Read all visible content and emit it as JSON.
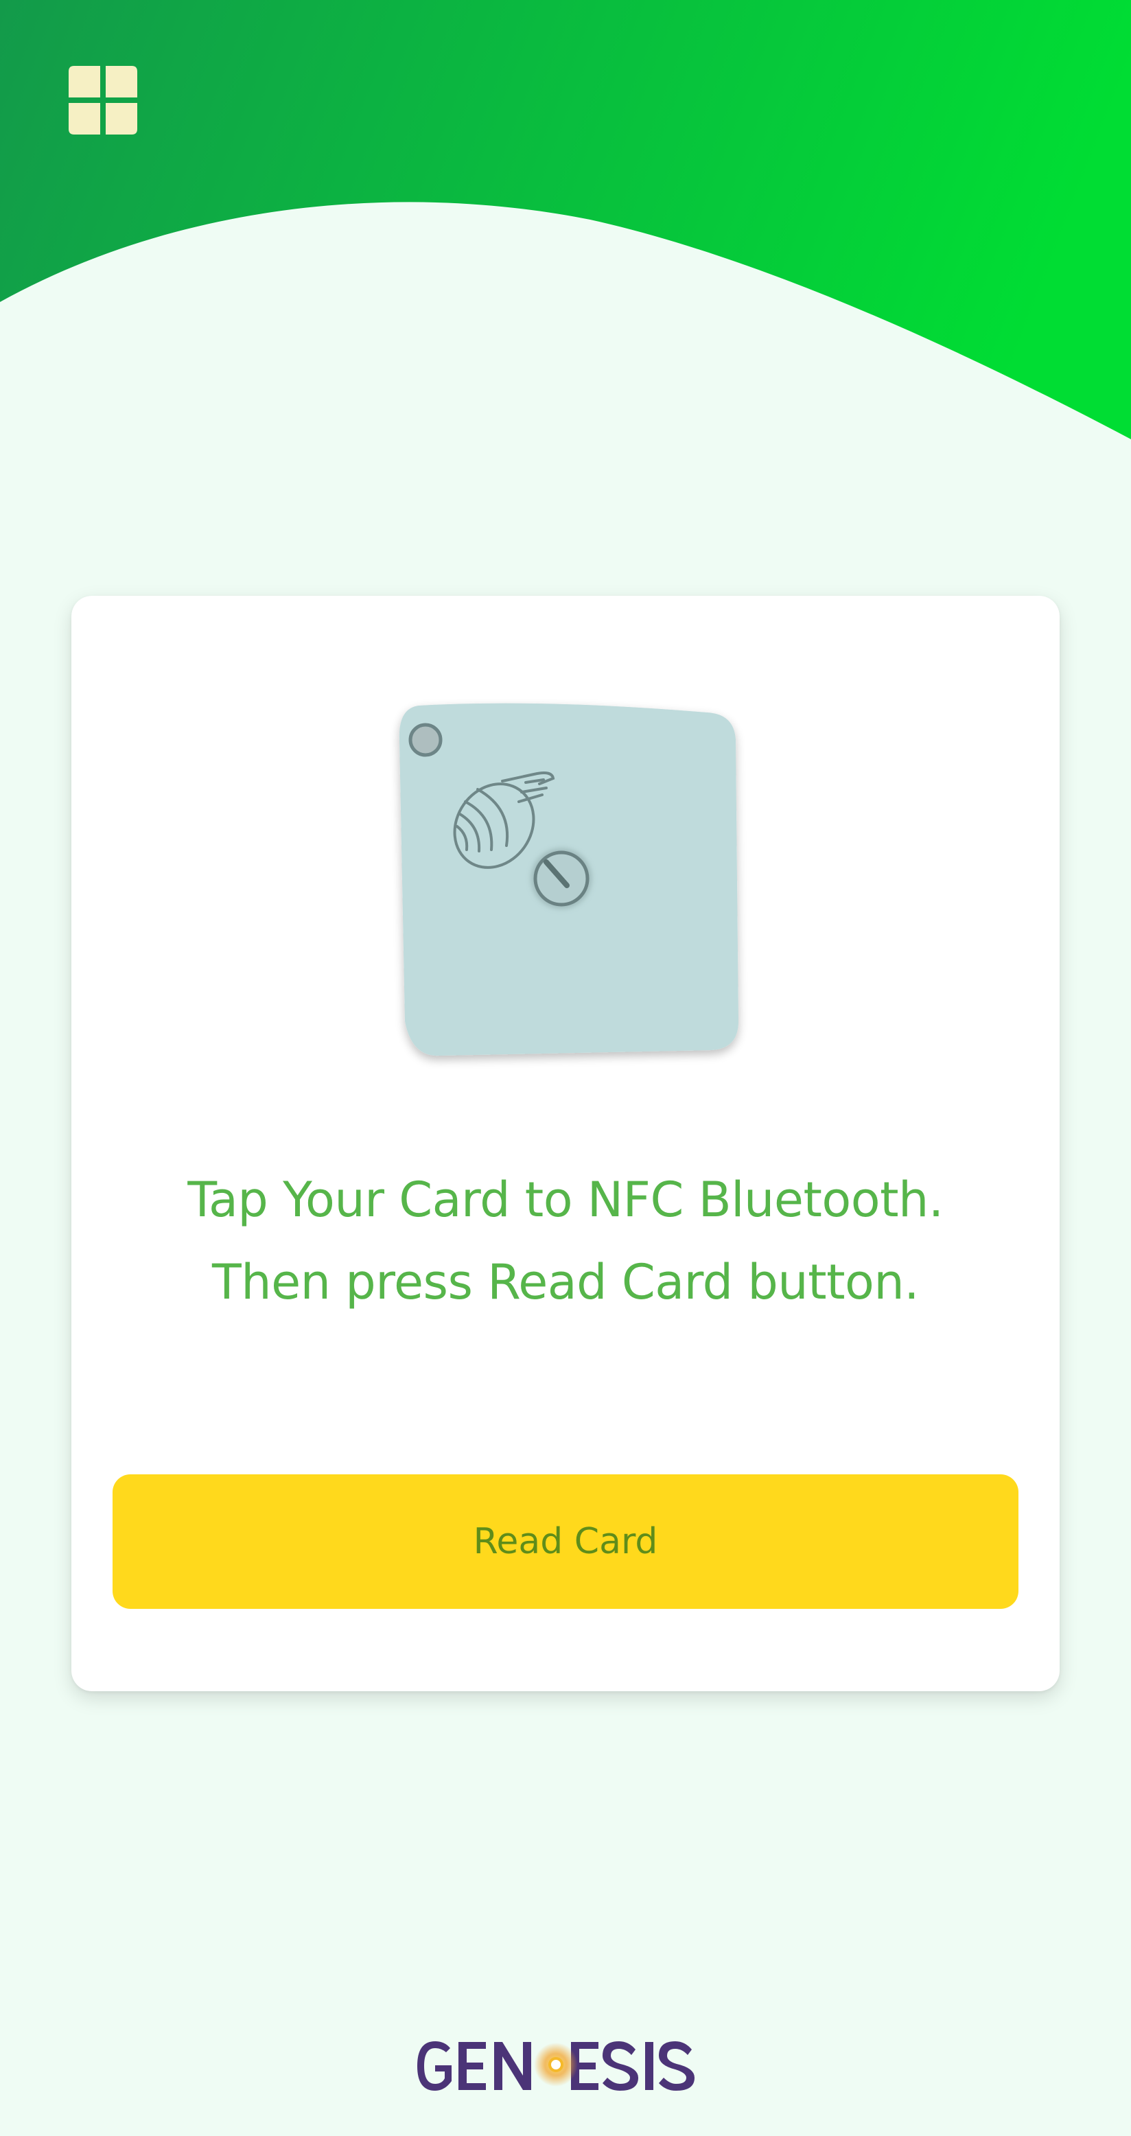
{
  "header": {
    "menu_icon": "grid-menu-icon",
    "gradient_start": "#139a4a",
    "gradient_end": "#00dd33"
  },
  "card": {
    "illustration_icon": "nfc-bluetooth-reader-icon",
    "instruction_line1": "Tap Your Card to NFC Bluetooth.",
    "instruction_line2": "Then press Read Card button.",
    "read_button_label": "Read Card"
  },
  "footer": {
    "brand_logo": "GENESIS"
  },
  "colors": {
    "background": "#effcf4",
    "accent_green": "#56b54a",
    "button_yellow": "#ffd91c",
    "button_text": "#5f8d1a",
    "logo_purple": "#4b3477"
  }
}
